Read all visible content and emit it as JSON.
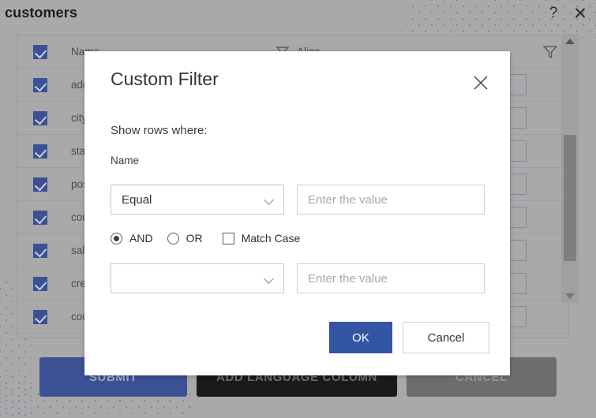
{
  "window": {
    "title": "customers",
    "help_icon": "question-mark-icon",
    "close_icon": "close-icon"
  },
  "grid": {
    "column_headers": [
      "Name",
      "Alias"
    ],
    "filter_icon": "funnel-icon",
    "rows": [
      {
        "label": "Name",
        "checked": true
      },
      {
        "label": "add",
        "checked": true
      },
      {
        "label": "city",
        "checked": true
      },
      {
        "label": "sta",
        "checked": true
      },
      {
        "label": "pos",
        "checked": true
      },
      {
        "label": "cou",
        "checked": true
      },
      {
        "label": "sal",
        "checked": true
      },
      {
        "label": "cre",
        "checked": true
      },
      {
        "label": "cou",
        "checked": true
      }
    ],
    "scrollbar": {
      "up_arrow": "triangle-up-icon",
      "down_arrow": "triangle-down-icon"
    }
  },
  "page_actions": {
    "submit": "SUBMIT",
    "add_language_column": "ADD LANGUAGE COLUMN",
    "cancel": "CANCEL"
  },
  "dialog": {
    "title": "Custom Filter",
    "close_icon": "close-icon",
    "show_rows_where": "Show rows where:",
    "field_name": "Name",
    "condition_1": {
      "operator_value": "Equal",
      "value": "",
      "value_placeholder": "Enter the value",
      "chevron_icon": "chevron-down-icon"
    },
    "logic": {
      "and_label": "AND",
      "or_label": "OR",
      "selected": "AND",
      "match_case_label": "Match Case",
      "match_case_checked": false
    },
    "condition_2": {
      "operator_value": "",
      "value": "",
      "value_placeholder": "Enter the value",
      "chevron_icon": "chevron-down-icon"
    },
    "ok_label": "OK",
    "cancel_label": "Cancel"
  },
  "colors": {
    "accent_blue": "#3454a4",
    "checkbox_blue": "#3b5193",
    "overlay_gray": "#a9a9a9",
    "dot_purple": "#7b7fb5"
  }
}
